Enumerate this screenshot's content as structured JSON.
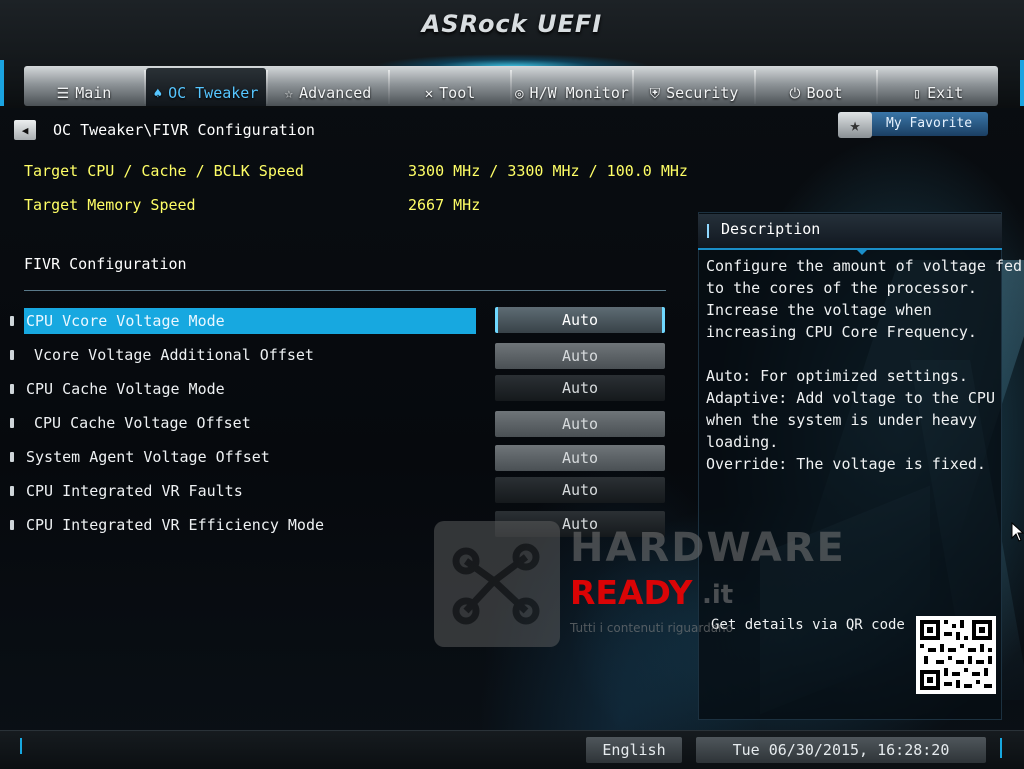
{
  "header": {
    "brand": "ASRock UEFI",
    "tabs": [
      {
        "label": "Main",
        "icon": "main-list-icon"
      },
      {
        "label": "OC Tweaker",
        "icon": "rocket-icon",
        "active": true
      },
      {
        "label": "Advanced",
        "icon": "star-advanced-icon"
      },
      {
        "label": "Tool",
        "icon": "tools-icon"
      },
      {
        "label": "H/W Monitor",
        "icon": "monitor-icon"
      },
      {
        "label": "Security",
        "icon": "shield-icon"
      },
      {
        "label": "Boot",
        "icon": "power-icon"
      },
      {
        "label": "Exit",
        "icon": "door-icon"
      }
    ],
    "accent_color": "#17a8e0"
  },
  "breadcrumb": "OC Tweaker\\FIVR Configuration",
  "favorite": {
    "label": "My Favorite"
  },
  "info": [
    {
      "label": "Target CPU / Cache / BCLK Speed",
      "value": "3300 MHz / 3300 MHz / 100.0 MHz"
    },
    {
      "label": "Target Memory Speed",
      "value": "2667 MHz"
    }
  ],
  "section_title": "FIVR Configuration",
  "settings": [
    {
      "label": "CPU Vcore Voltage Mode",
      "value": "Auto"
    },
    {
      "label": "Vcore Voltage Additional Offset",
      "value": "Auto"
    },
    {
      "label": "CPU Cache Voltage Mode",
      "value": "Auto"
    },
    {
      "label": "CPU Cache Voltage Offset",
      "value": "Auto"
    },
    {
      "label": "System Agent Voltage Offset",
      "value": "Auto"
    },
    {
      "label": "CPU Integrated VR Faults",
      "value": "Auto"
    },
    {
      "label": "CPU Integrated VR Efficiency Mode",
      "value": "Auto"
    }
  ],
  "description": {
    "title": "Description",
    "lines": [
      "Configure the amount of voltage fed",
      "to the cores of the processor.",
      "Increase the voltage when",
      "increasing CPU Core Frequency.",
      "",
      "Auto: For optimized settings.",
      "Adaptive: Add voltage to the CPU",
      "when the system is under heavy",
      "loading.",
      "Override: The voltage is fixed."
    ],
    "qr_label": "Get details via QR code"
  },
  "watermark": {
    "line1": "HARDWARE",
    "line2": "READY",
    "line3": ".it",
    "line4": "Tutti i contenuti riguardano"
  },
  "footer": {
    "language": "English",
    "datetime": "Tue 06/30/2015, 16:28:20"
  }
}
